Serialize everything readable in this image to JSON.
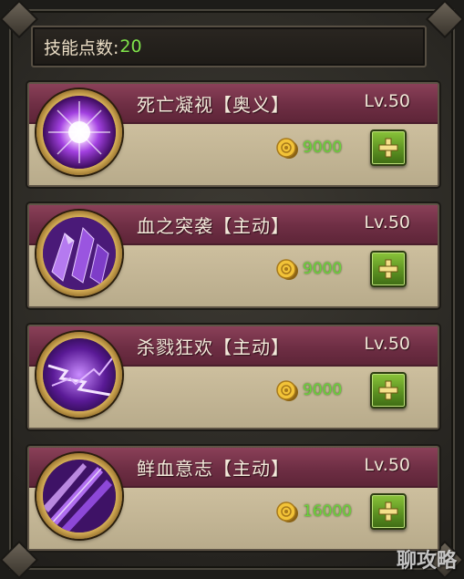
{
  "header": {
    "points_label": "技能点数:",
    "points_value": "20"
  },
  "skills": [
    {
      "name": "死亡凝视【奥义】",
      "level": "Lv.50",
      "cost": "9000",
      "icon": "purple-orb-burst-icon"
    },
    {
      "name": "血之突袭【主动】",
      "level": "Lv.50",
      "cost": "9000",
      "icon": "purple-crystal-shards-icon"
    },
    {
      "name": "杀戮狂欢【主动】",
      "level": "Lv.50",
      "cost": "9000",
      "icon": "purple-lightning-icon"
    },
    {
      "name": "鲜血意志【主动】",
      "level": "Lv.50",
      "cost": "16000",
      "icon": "purple-slash-icon"
    }
  ],
  "watermark": {
    "text": "聊攻略"
  },
  "colors": {
    "header_band": "#6e2e44",
    "card_body": "#c4b797",
    "cost_green": "#6ad33a",
    "points_green": "#7fe34a",
    "button_green": "#5c9222"
  }
}
